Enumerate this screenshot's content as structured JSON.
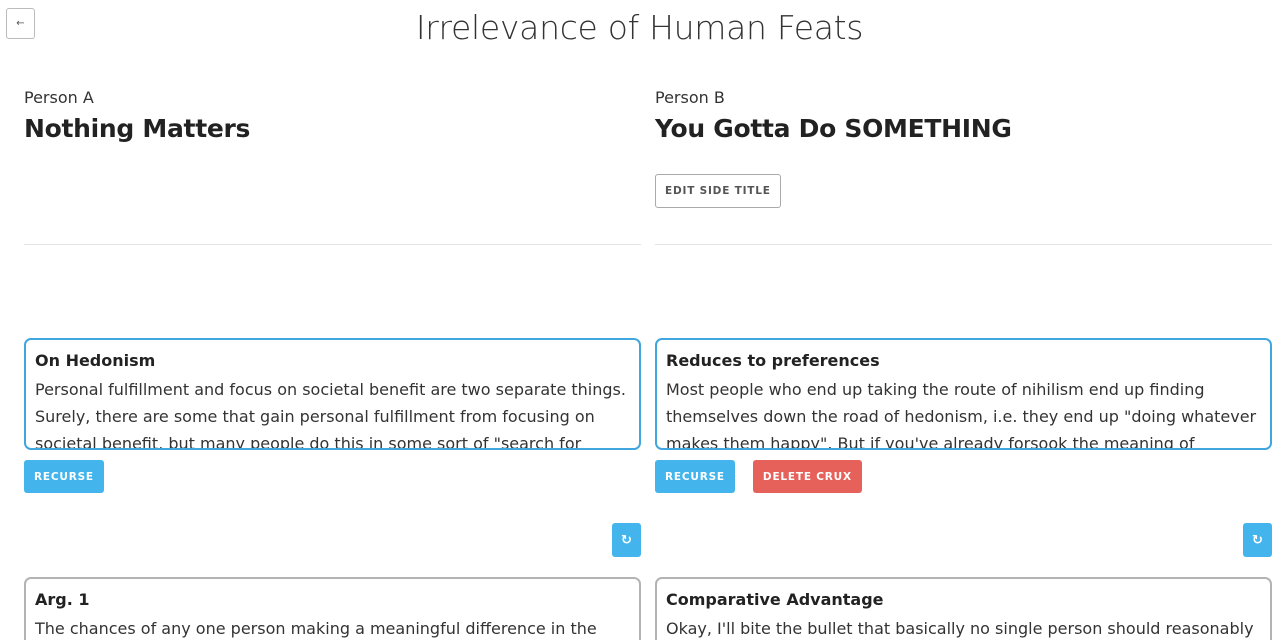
{
  "header": {
    "back_label": "←",
    "title": "Irrelevance of Human Feats"
  },
  "colors": {
    "accent": "#43b5ec",
    "danger": "#e7615b",
    "card_border_active": "#3fa7dd",
    "card_border_inactive": "#b3b3b3"
  },
  "side_a": {
    "person_label": "Person A",
    "side_title": "Nothing Matters",
    "crux": {
      "title": "On Hedonism",
      "body": "Personal fulfillment and focus on societal benefit are two separate things. Surely, there are some that gain personal fulfillment from focusing on societal benefit, but many people do this in some sort of \"search for"
    },
    "recurse_label": "RECURSE",
    "refresh_icon": "↻",
    "arg": {
      "title": "Arg. 1",
      "body": "The chances of any one person making a meaningful difference in the world"
    }
  },
  "side_b": {
    "person_label": "Person B",
    "side_title": "You Gotta Do SOMETHING",
    "edit_label": "EDIT SIDE TITLE",
    "crux": {
      "title": "Reduces to preferences",
      "body": "Most people who end up taking the route of nihilism end up finding themselves down the road of hedonism, i.e. they end up \"doing whatever makes them happy\". But if you've already forsook the meaning of everything,"
    },
    "recurse_label": "RECURSE",
    "delete_label": "DELETE CRUX",
    "refresh_icon": "↻",
    "arg": {
      "title": "Comparative Advantage",
      "body": "Okay, I'll bite the bullet that basically no single person should reasonably"
    }
  }
}
